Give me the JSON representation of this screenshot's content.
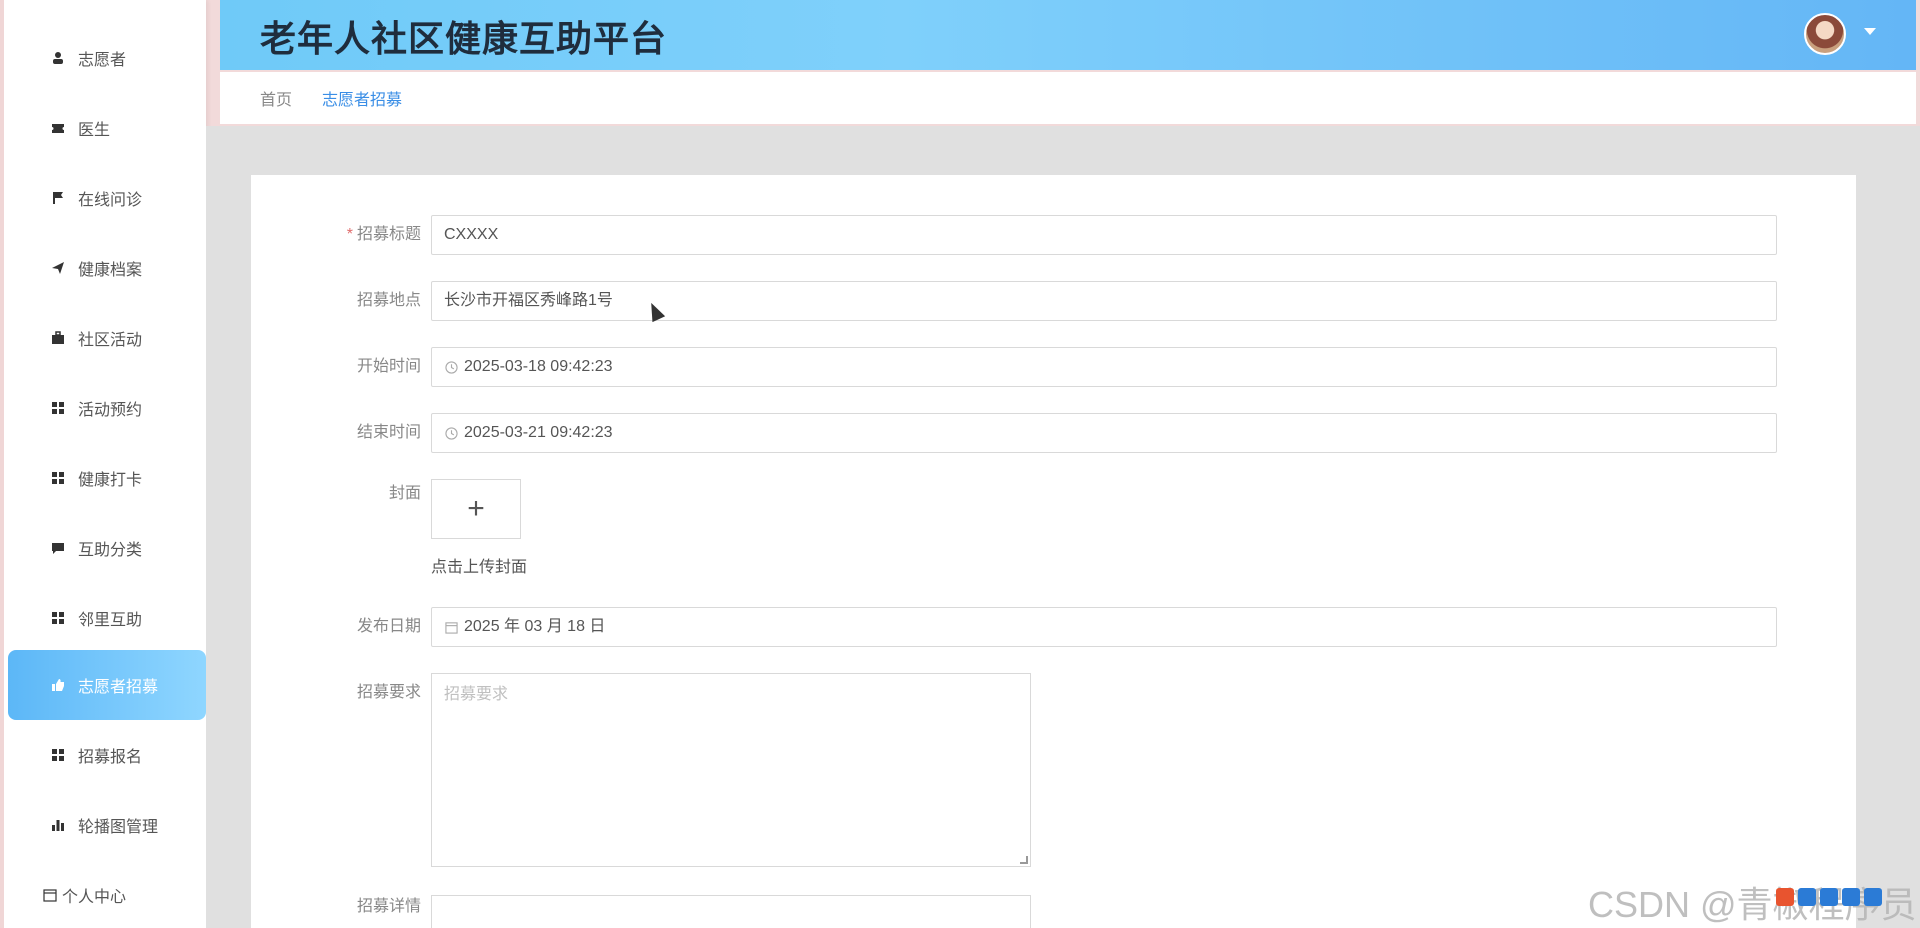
{
  "header": {
    "title": "老年人社区健康互助平台"
  },
  "breadcrumb": {
    "home": "首页",
    "current": "志愿者招募"
  },
  "sidebar": {
    "items": [
      {
        "label": "志愿者",
        "icon": "user-icon"
      },
      {
        "label": "医生",
        "icon": "ticket-icon"
      },
      {
        "label": "在线问诊",
        "icon": "flag-icon"
      },
      {
        "label": "健康档案",
        "icon": "send-icon"
      },
      {
        "label": "社区活动",
        "icon": "briefcase-icon"
      },
      {
        "label": "活动预约",
        "icon": "grid-icon"
      },
      {
        "label": "健康打卡",
        "icon": "grid-icon"
      },
      {
        "label": "互助分类",
        "icon": "comment-icon"
      },
      {
        "label": "邻里互助",
        "icon": "grid-icon"
      },
      {
        "label": "志愿者招募",
        "icon": "thumbs-up-icon",
        "active": true
      },
      {
        "label": "招募报名",
        "icon": "grid-icon"
      },
      {
        "label": "轮播图管理",
        "icon": "bar-chart-icon"
      },
      {
        "label": "个人中心",
        "icon": "calendar-icon"
      }
    ]
  },
  "form": {
    "title_label": "招募标题",
    "title_value": "CXXXX",
    "location_label": "招募地点",
    "location_value": "长沙市开福区秀峰路1号",
    "start_label": "开始时间",
    "start_value": "2025-03-18 09:42:23",
    "end_label": "结束时间",
    "end_value": "2025-03-21 09:42:23",
    "cover_label": "封面",
    "cover_hint": "点击上传封面",
    "publish_label": "发布日期",
    "publish_value": "2025 年 03 月 18 日",
    "requirement_label": "招募要求",
    "requirement_placeholder": "招募要求",
    "detail_label": "招募详情"
  },
  "watermark": "CSDN @青椒程序员",
  "colors": {
    "accent": "#3a8ee6",
    "active_bg": "#6cc4f8",
    "header_bg": "#70c8f8"
  }
}
